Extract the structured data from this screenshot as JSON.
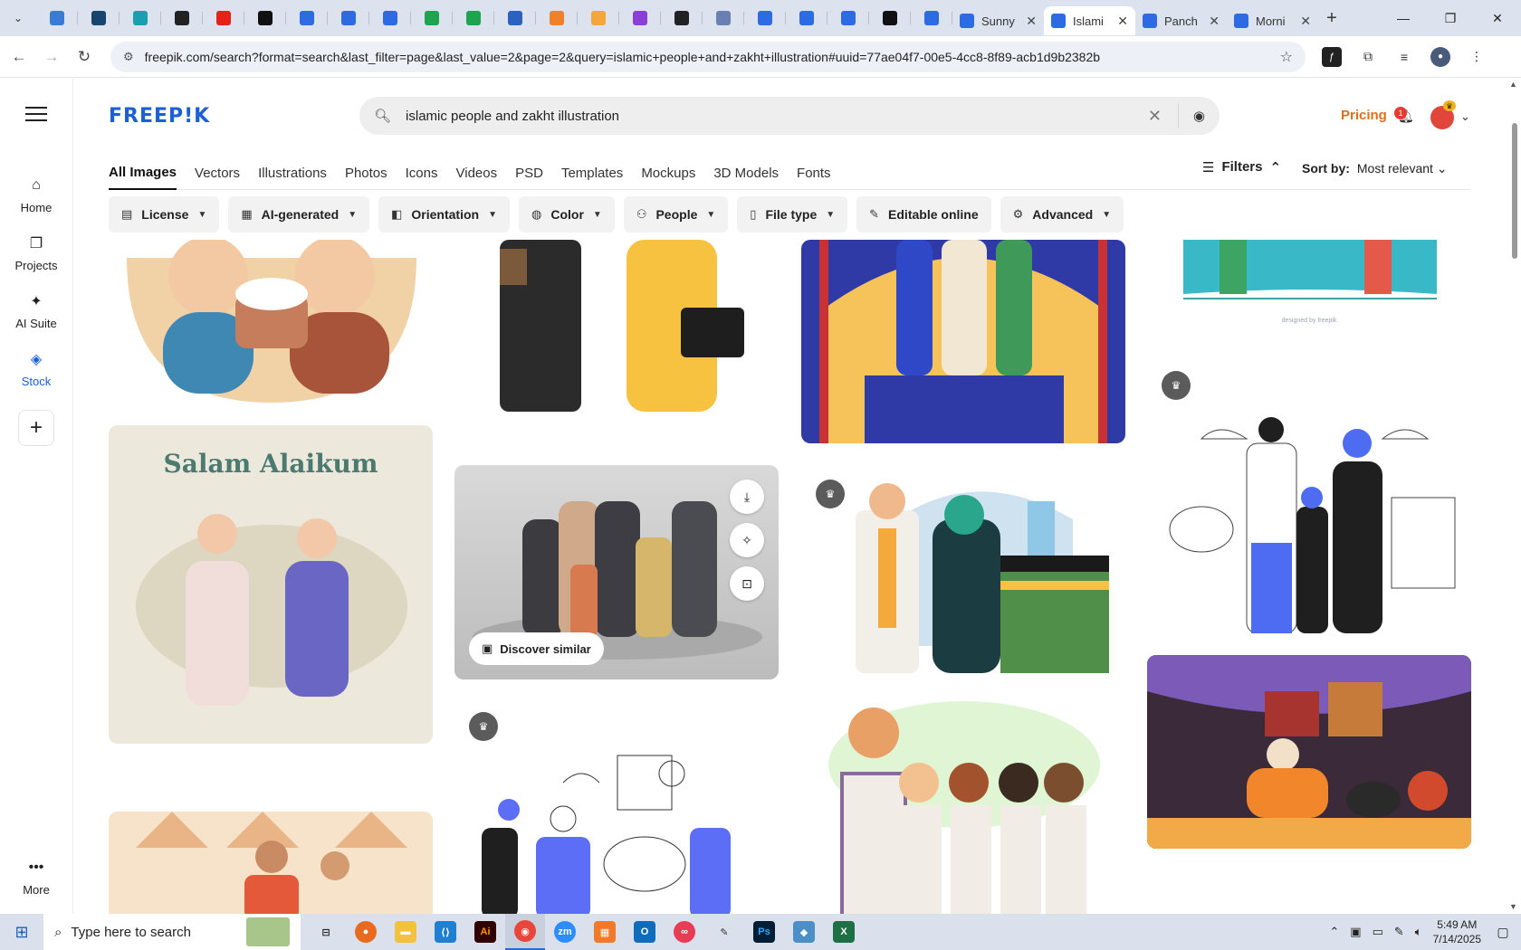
{
  "browser": {
    "pinned_tabs": [
      {
        "icon": "globe-icon",
        "color": "#3b7bd6"
      },
      {
        "icon": "shield-icon",
        "color": "#17456d"
      },
      {
        "icon": "play-icon",
        "color": "#1a9fb0"
      },
      {
        "icon": "openai-icon",
        "color": "#222222"
      },
      {
        "icon": "youtube-icon",
        "color": "#e62117"
      },
      {
        "icon": "bolt-icon",
        "color": "#111111"
      },
      {
        "icon": "docs-icon",
        "color": "#2d6be4"
      },
      {
        "icon": "docs-icon",
        "color": "#2d6be4"
      },
      {
        "icon": "docs-icon",
        "color": "#2d6be4"
      },
      {
        "icon": "sheets-icon",
        "color": "#1ea34f"
      },
      {
        "icon": "sheets-icon",
        "color": "#1ea34f"
      },
      {
        "icon": "word-icon",
        "color": "#2b62c0"
      },
      {
        "icon": "grid-icon",
        "color": "#f0812a"
      },
      {
        "icon": "v-icon",
        "color": "#f4a53b"
      },
      {
        "icon": "braces-icon",
        "color": "#8b3fd6"
      },
      {
        "icon": "a-icon",
        "color": "#222222"
      },
      {
        "icon": "table-icon",
        "color": "#6a7fb4"
      },
      {
        "icon": "forms-icon",
        "color": "#2d6be4"
      },
      {
        "icon": "forms-icon",
        "color": "#2d6be4"
      },
      {
        "icon": "forms-icon",
        "color": "#2d6be4"
      },
      {
        "icon": "m-icon",
        "color": "#111111"
      },
      {
        "icon": "forms-icon",
        "color": "#2d6be4"
      }
    ],
    "tabs": [
      {
        "label": "Sunny",
        "active": false
      },
      {
        "label": "Islami",
        "active": true
      },
      {
        "label": "Panch",
        "active": false
      },
      {
        "label": "Morni",
        "active": false
      }
    ],
    "new_tab_label": "+",
    "url": "freepik.com/search?format=search&last_filter=page&last_value=2&page=2&query=islamic+people+and+zakht+illustration#uuid=77ae04f7-00e5-4cc8-8f89-acb1d9b2382b"
  },
  "sidebar": {
    "items": [
      {
        "label": "Home",
        "icon": "home-icon"
      },
      {
        "label": "Projects",
        "icon": "projects-icon"
      },
      {
        "label": "AI Suite",
        "icon": "sparkle-icon"
      },
      {
        "label": "Stock",
        "icon": "stock-icon"
      }
    ],
    "more_label": "More"
  },
  "header": {
    "logo": "FREEP!K",
    "search_value": "islamic people and zakht illustration",
    "pricing_label": "Pricing",
    "notification_count": "1"
  },
  "content_tabs": [
    {
      "label": "All Images",
      "active": true
    },
    {
      "label": "Vectors",
      "active": false
    },
    {
      "label": "Illustrations",
      "active": false
    },
    {
      "label": "Photos",
      "active": false
    },
    {
      "label": "Icons",
      "active": false
    },
    {
      "label": "Videos",
      "active": false
    },
    {
      "label": "PSD",
      "active": false
    },
    {
      "label": "Templates",
      "active": false
    },
    {
      "label": "Mockups",
      "active": false
    },
    {
      "label": "3D Models",
      "active": false
    },
    {
      "label": "Fonts",
      "active": false
    }
  ],
  "filters_label": "Filters",
  "sort": {
    "label": "Sort by:",
    "value": "Most relevant"
  },
  "filter_chips": [
    {
      "label": "License",
      "icon": "license-icon"
    },
    {
      "label": "AI-generated",
      "icon": "ai-icon"
    },
    {
      "label": "Orientation",
      "icon": "orientation-icon"
    },
    {
      "label": "Color",
      "icon": "palette-icon"
    },
    {
      "label": "People",
      "icon": "people-icon"
    },
    {
      "label": "File type",
      "icon": "file-icon"
    },
    {
      "label": "Editable online",
      "icon": "pen-icon"
    },
    {
      "label": "Advanced",
      "icon": "gear-icon"
    }
  ],
  "grid": {
    "salam_text": "Salam Alaikum",
    "discover_label": "Discover similar",
    "credit_text": "designed by freepik"
  },
  "taskbar": {
    "search_placeholder": "Type here to search",
    "time": "5:49 AM",
    "date": "7/14/2025"
  }
}
